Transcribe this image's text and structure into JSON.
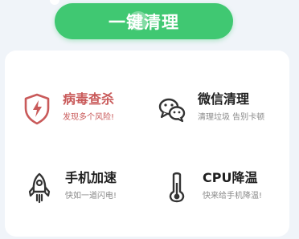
{
  "primary_action": {
    "label": "一键清理"
  },
  "features": [
    {
      "title": "病毒查杀",
      "subtitle": "发现多个风险!",
      "icon": "shield-lightning-icon",
      "status_color": "#c95a5a"
    },
    {
      "title": "微信清理",
      "subtitle": "清理垃圾 告别卡顿",
      "icon": "wechat-icon"
    },
    {
      "title": "手机加速",
      "subtitle": "快如一道闪电!",
      "icon": "rocket-icon"
    },
    {
      "title": "CPU降温",
      "subtitle": "快来给手机降温!",
      "icon": "thermometer-icon"
    }
  ],
  "colors": {
    "accent": "#40c872",
    "warning": "#c95a5a",
    "icon": "#333333"
  }
}
